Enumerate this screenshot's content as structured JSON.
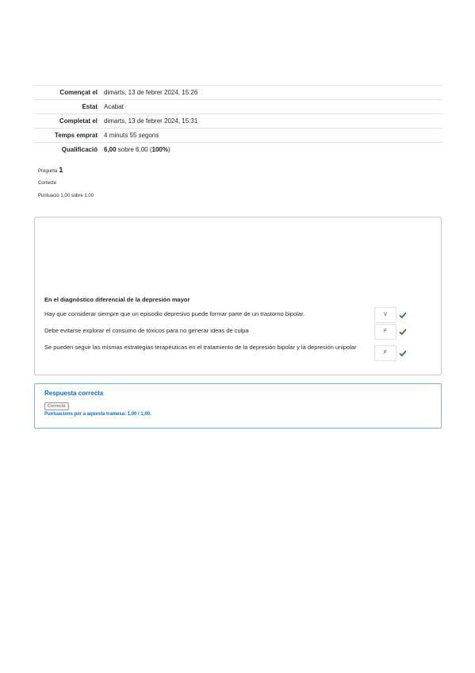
{
  "summary": {
    "rows": [
      {
        "label": "Començat el",
        "value": "dimarts, 13 de febrer 2024, 15:26"
      },
      {
        "label": "Estat",
        "value": "Acabat"
      },
      {
        "label": "Completat el",
        "value": "dimarts, 13 de febrer 2024, 15:31"
      },
      {
        "label": "Temps emprat",
        "value": "4 minuts 55 segons"
      }
    ],
    "grade": {
      "label": "Qualificació",
      "score": "6,00",
      "middle": " sobre 6,00 (",
      "percent": "100%",
      "end": ")"
    }
  },
  "question": {
    "label": "Pregunta",
    "number": "1",
    "state": "Correcte",
    "grade": "Puntuació 1,00 sobre 1,00",
    "text": "En el diagnóstico diferencial de la depresión mayor",
    "items": [
      {
        "text": "Hay que considerar siempre que un episodio depresivo puede formar parte de un trastorno bipolar.",
        "answer": "V"
      },
      {
        "text": "Debe evitarse explorar el consumo de tóxicos para no generar ideas de culpa",
        "answer": "F"
      },
      {
        "text": "Se pueden seguir las mismas estrategias terapéuticas en el tratamiento de la depresión bipolar y la depresión unipolar",
        "answer": "F"
      }
    ]
  },
  "feedback": {
    "heading": "Respuesta correcta",
    "badge": "Correcte",
    "score": "Puntuacions per a aquesta tramesa: 1,00 / 1,00."
  },
  "colors": {
    "check": "#357a32",
    "link_blue": "#0f6cbf",
    "feedback_border": "#7fb1e2"
  }
}
